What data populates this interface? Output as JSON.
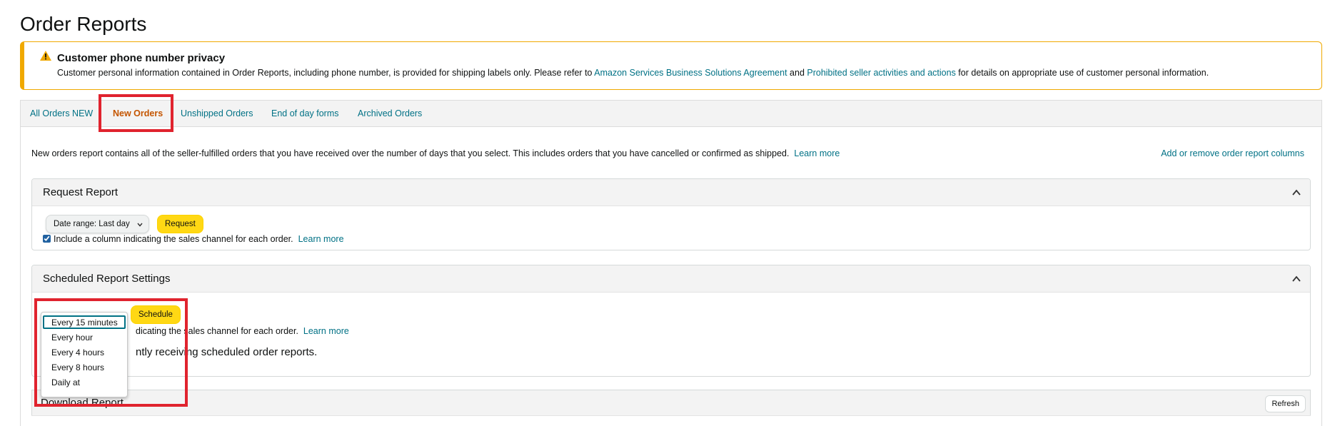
{
  "page": {
    "title": "Order Reports"
  },
  "alert": {
    "title": "Customer phone number privacy",
    "text_before": "Customer personal information contained in Order Reports, including phone number, is provided for shipping labels only. Please refer to ",
    "link1": "Amazon Services Business Solutions Agreement",
    "text_middle": " and ",
    "link2": "Prohibited seller activities and actions",
    "text_after": " for details on appropriate use of customer personal information.",
    "icon": "warning-icon",
    "color": "#f0a900"
  },
  "tabs": [
    {
      "label": "All Orders NEW"
    },
    {
      "label": "New Orders",
      "active": true
    },
    {
      "label": "Unshipped Orders"
    },
    {
      "label": "End of day forms"
    },
    {
      "label": "Archived Orders"
    }
  ],
  "description": {
    "text": "New orders report contains all of the seller-fulfilled orders that you have received over the number of days that you select. This includes orders that you have cancelled or confirmed as shipped.",
    "learn_more": "Learn more",
    "add_remove_link": "Add or remove order report columns"
  },
  "request_report": {
    "title": "Request Report",
    "date_range_value": "Date range: Last day",
    "request_label": "Request",
    "checkbox_label": "Include a column indicating the sales channel for each order.",
    "learn_more": "Learn more"
  },
  "scheduled_settings": {
    "title": "Scheduled Report Settings",
    "schedule_label": "Schedule",
    "checkbox_label_visible": "dicating the sales channel for each order.",
    "learn_more": "Learn more",
    "no_schedule_visible": "ntly receiving scheduled order reports.",
    "frequency_options": [
      "Every 15 minutes",
      "Every hour",
      "Every 4 hours",
      "Every 8 hours",
      "Daily at"
    ],
    "selected_option": "Every 15 minutes"
  },
  "download_report": {
    "title": "Download Report",
    "refresh_label": "Refresh"
  },
  "colors": {
    "accent_link": "#007185",
    "active_tab": "#c45500",
    "button_yellow": "#ffd814",
    "highlight": "#e0232e"
  }
}
